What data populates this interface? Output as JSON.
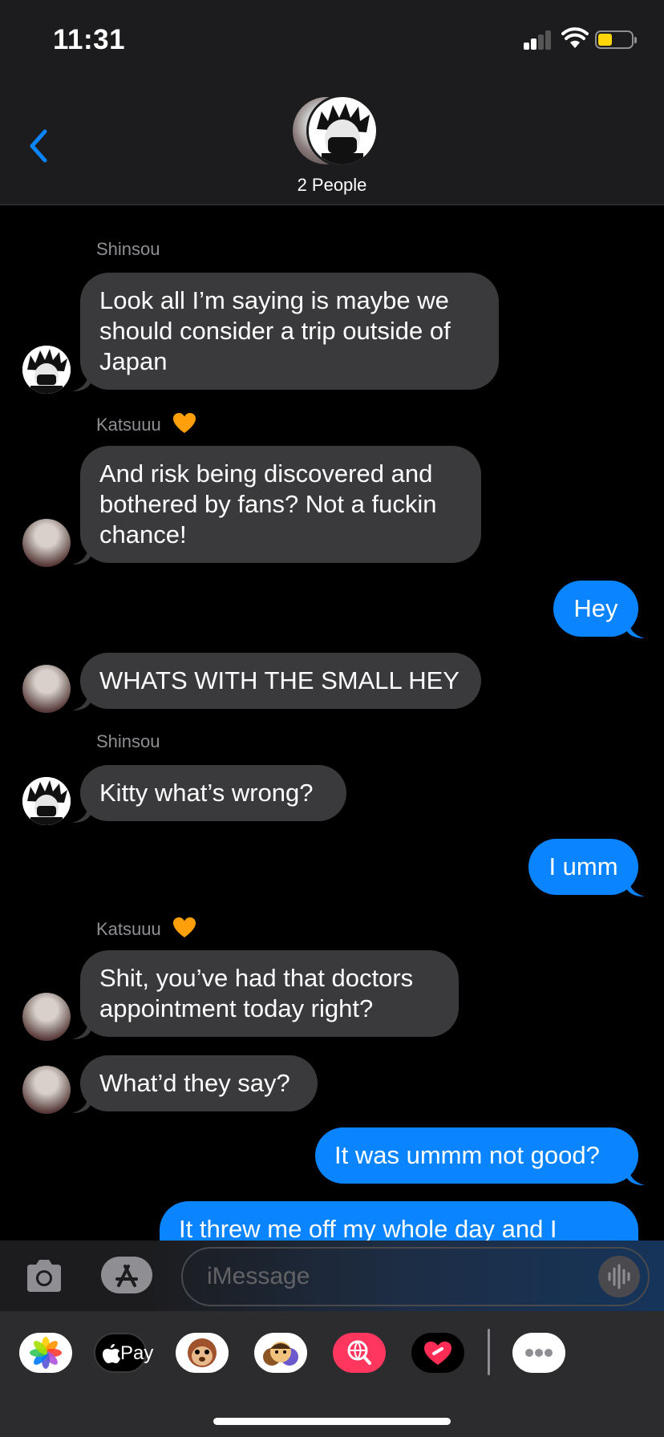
{
  "status_bar": {
    "time": "11:31"
  },
  "header": {
    "group_label": "2 People"
  },
  "messages": [
    {
      "sender": "Shinsou",
      "text": "Look all I’m saying is maybe we should consider a trip outside of Japan"
    },
    {
      "sender": "Katsuuu",
      "text": "And risk being discovered and bothered by fans? Not a fuckin chance!"
    },
    {
      "sender": "",
      "text": "Hey"
    },
    {
      "sender": "",
      "text": "WHATS WITH THE SMALL HEY"
    },
    {
      "sender": "Shinsou",
      "text": "Kitty what’s wrong?"
    },
    {
      "sender": "",
      "text": "I umm"
    },
    {
      "sender": "Katsuuu",
      "text": "Shit, you’ve had that doctors appointment today right?"
    },
    {
      "sender": "",
      "text": "What’d they say?"
    },
    {
      "sender": "",
      "text": "It was ummm not good?"
    },
    {
      "sender": "",
      "text": "It threw me off my whole day and I"
    }
  ],
  "input": {
    "placeholder": "iMessage"
  },
  "colors": {
    "outgoing": "#0a84ff",
    "incoming": "#3a3a3c",
    "heart": "#ff9f0a"
  },
  "tray_apps": [
    "photos-icon",
    "apple-pay-icon",
    "animoji-icon",
    "memoji-icon",
    "search-images-icon",
    "digital-touch-icon",
    "more-icon"
  ],
  "tray_labels": {
    "apple_pay": "Pay"
  }
}
